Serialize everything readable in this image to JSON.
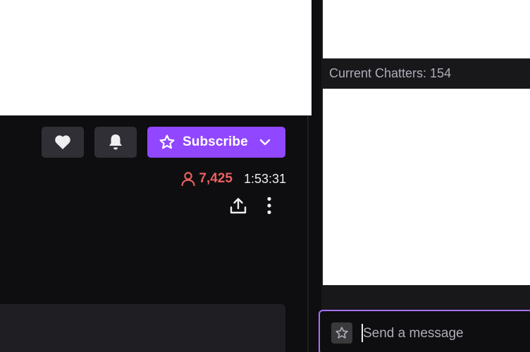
{
  "channel_actions": {
    "follow_icon": "heart-icon",
    "notifications_icon": "bell-icon",
    "subscribe_label": "Subscribe",
    "subscribe_icon": "star-icon",
    "subscribe_dropdown_icon": "chevron-down-icon",
    "share_icon": "share-icon",
    "more_icon": "more-vertical-icon"
  },
  "stream_stats": {
    "viewer_count": "7,425",
    "viewer_icon": "person-icon",
    "uptime": "1:53:31"
  },
  "chat": {
    "chatters_label": "Current Chatters: 154",
    "input_placeholder": "Send a message",
    "emote_icon": "star-icon"
  },
  "colors": {
    "accent_purple": "#9147ff",
    "viewer_red": "#eb5f5f",
    "input_focus_border": "#a970ff"
  }
}
